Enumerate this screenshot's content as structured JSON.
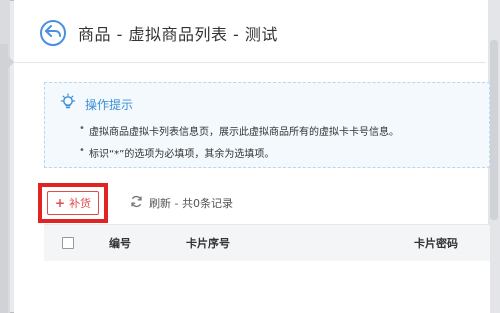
{
  "header": {
    "title": "商品 - 虚拟商品列表 - 测试",
    "back_icon": "back-arrow-icon"
  },
  "tips": {
    "title": "操作提示",
    "icon": "lightbulb-icon",
    "lines": [
      "虚拟商品虚拟卡列表信息页，展示此虚拟商品所有的虚拟卡卡号信息。",
      "标识“*”的选项为必填项，其余为选填项。"
    ]
  },
  "toolbar": {
    "add_label": "补货",
    "refresh_label": "刷新 - 共0条记录",
    "highlight_color": "#e02424"
  },
  "table": {
    "columns": [
      "编号",
      "卡片序号",
      "卡片密码"
    ]
  },
  "colors": {
    "accent": "#4a90e2",
    "tip_text": "#3a8fd6",
    "danger": "#e04b4b"
  }
}
